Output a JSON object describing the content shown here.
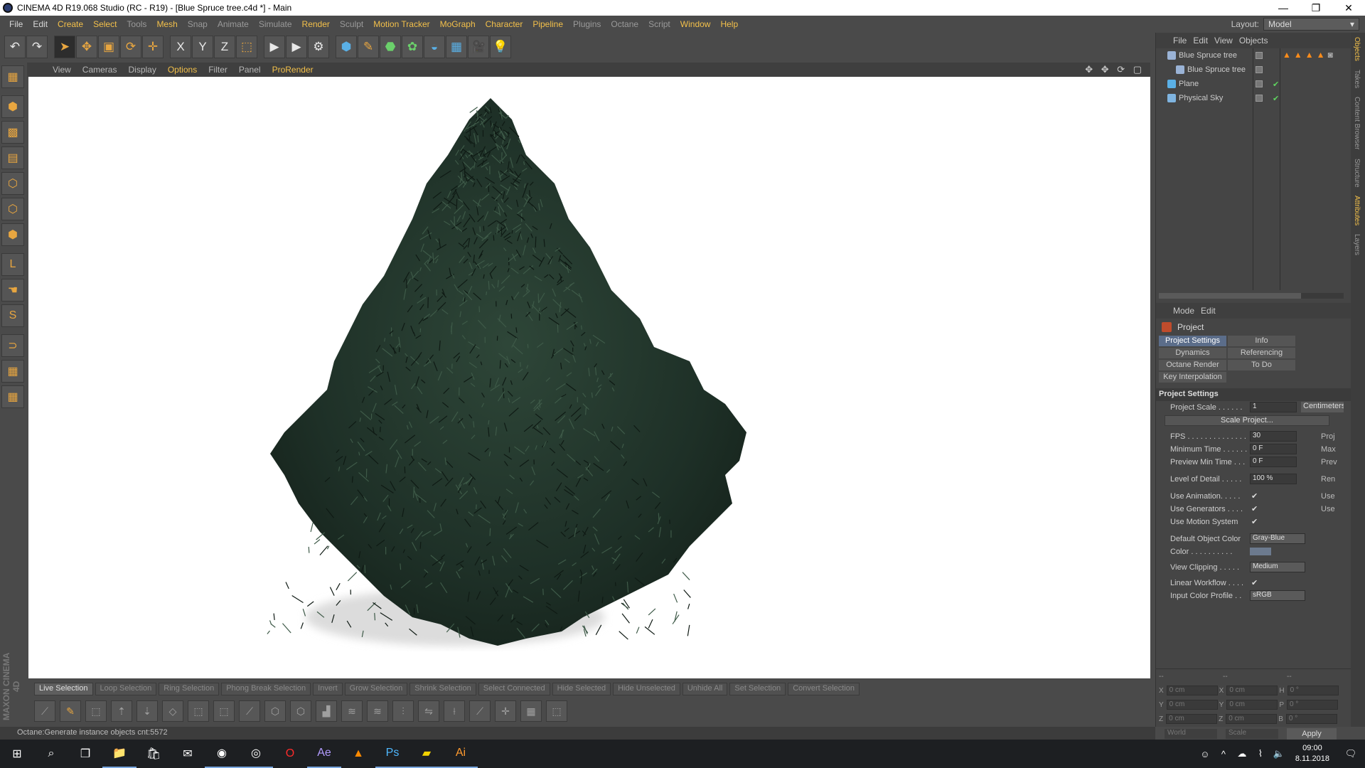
{
  "window": {
    "title": "CINEMA 4D R19.068 Studio (RC - R19) - [Blue Spruce tree.c4d *] - Main",
    "minimize": "—",
    "maximize": "❐",
    "close": "✕"
  },
  "menubar": {
    "items": [
      "File",
      "Edit",
      "Create",
      "Select",
      "Tools",
      "Mesh",
      "Snap",
      "Animate",
      "Simulate",
      "Render",
      "Sculpt",
      "Motion Tracker",
      "MoGraph",
      "Character",
      "Pipeline",
      "Plugins",
      "Octane",
      "Script",
      "Window",
      "Help"
    ],
    "layout_label": "Layout:",
    "layout_value": "Model"
  },
  "viewport_menu": {
    "items": [
      "View",
      "Cameras",
      "Display",
      "Options",
      "Filter",
      "Panel",
      "ProRender"
    ],
    "nav_icons": "✥ ✥ ⟳ ▢"
  },
  "toolbar": {
    "buttons": [
      {
        "name": "undo-icon",
        "glyph": "↶"
      },
      {
        "name": "redo-icon",
        "glyph": "↷"
      },
      {
        "name": "live-selection-icon",
        "glyph": "➤"
      },
      {
        "name": "move-icon",
        "glyph": "✥"
      },
      {
        "name": "scale-icon",
        "glyph": "▣"
      },
      {
        "name": "rotate-icon",
        "glyph": "⟳"
      },
      {
        "name": "add-icon",
        "glyph": "✛"
      },
      {
        "name": "x-axis-icon",
        "glyph": "X"
      },
      {
        "name": "y-axis-icon",
        "glyph": "Y"
      },
      {
        "name": "z-axis-icon",
        "glyph": "Z"
      },
      {
        "name": "coordinate-system-icon",
        "glyph": "⬚"
      },
      {
        "name": "render-view-icon",
        "glyph": "▶"
      },
      {
        "name": "render-picture-viewer-icon",
        "glyph": "▶"
      },
      {
        "name": "render-settings-icon",
        "glyph": "⚙"
      },
      {
        "name": "cube-icon",
        "glyph": "⬢"
      },
      {
        "name": "pen-icon",
        "glyph": "✎"
      },
      {
        "name": "subdivision-icon",
        "glyph": "⬣"
      },
      {
        "name": "cloner-icon",
        "glyph": "✿"
      },
      {
        "name": "deformer-icon",
        "glyph": "◒"
      },
      {
        "name": "floor-icon",
        "glyph": "▦"
      },
      {
        "name": "camera-icon",
        "glyph": "🎥"
      },
      {
        "name": "light-icon",
        "glyph": "💡"
      }
    ]
  },
  "left_tools": [
    {
      "name": "make-editable-icon",
      "glyph": "▦"
    },
    {
      "name": "model-mode-icon",
      "glyph": "⬢"
    },
    {
      "name": "texture-mode-icon",
      "glyph": "▩"
    },
    {
      "name": "workplane-icon",
      "glyph": "▤"
    },
    {
      "name": "points-mode-icon",
      "glyph": "⬡"
    },
    {
      "name": "edges-mode-icon",
      "glyph": "⬡"
    },
    {
      "name": "polygons-mode-icon",
      "glyph": "⬢"
    },
    {
      "name": "axis-mode-icon",
      "glyph": "L"
    },
    {
      "name": "tweak-mode-icon",
      "glyph": "☚"
    },
    {
      "name": "snap-icon",
      "glyph": "S"
    },
    {
      "name": "magnet-icon",
      "glyph": "⊃"
    },
    {
      "name": "workplane-lock-icon",
      "glyph": "▦"
    },
    {
      "name": "viewport-solo-icon",
      "glyph": "▦"
    }
  ],
  "brand": {
    "logo_text": "MAXON CINEMA 4D"
  },
  "selection_bar": {
    "buttons": [
      "Live Selection",
      "Loop Selection",
      "Ring Selection",
      "Phong Break Selection",
      "Invert",
      "Grow Selection",
      "Shrink Selection",
      "Select Connected",
      "Hide Selected",
      "Hide Unselected",
      "Unhide All",
      "Set Selection",
      "Convert Selection"
    ]
  },
  "bottom_tools": [
    {
      "name": "knife-icon",
      "glyph": "⟋"
    },
    {
      "name": "brush-icon",
      "glyph": "✎"
    },
    {
      "name": "iron-icon",
      "glyph": "⬚"
    },
    {
      "name": "extrude-icon",
      "glyph": "⇡"
    },
    {
      "name": "extrude-inner-icon",
      "glyph": "⇣"
    },
    {
      "name": "bevel-icon",
      "glyph": "◇"
    },
    {
      "name": "bridge-icon",
      "glyph": "⬚"
    },
    {
      "name": "weld-icon",
      "glyph": "⬚"
    },
    {
      "name": "slide-icon",
      "glyph": "⟋"
    },
    {
      "name": "stitch-icon",
      "glyph": "⬡"
    },
    {
      "name": "close-hole-icon",
      "glyph": "⬡"
    },
    {
      "name": "mirror-icon",
      "glyph": "▟"
    },
    {
      "name": "melt-icon",
      "glyph": "≋"
    },
    {
      "name": "dissolve-icon",
      "glyph": "≋"
    },
    {
      "name": "align-normals-icon",
      "glyph": "⫶"
    },
    {
      "name": "reverse-normals-icon",
      "glyph": "⇋"
    },
    {
      "name": "line-cut-icon",
      "glyph": "⟊"
    },
    {
      "name": "plane-cut-icon",
      "glyph": "⟋"
    },
    {
      "name": "add-point-icon",
      "glyph": "✛"
    },
    {
      "name": "array-icon",
      "glyph": "▦"
    },
    {
      "name": "optimize-icon",
      "glyph": "⬚"
    }
  ],
  "status": {
    "text": "Octane:Generate instance objects cnt:5572"
  },
  "object_manager": {
    "menu": [
      "File",
      "Edit",
      "View",
      "Objects"
    ],
    "objects": [
      {
        "name": "Blue Spruce tree",
        "indent": 0,
        "icon_color": "#9ab3d6",
        "checked": false
      },
      {
        "name": "Blue Spruce tree",
        "indent": 1,
        "icon_color": "#9ab3d6",
        "checked": false
      },
      {
        "name": "Plane",
        "indent": 0,
        "icon_color": "#5ab0e6",
        "checked": true
      },
      {
        "name": "Physical Sky",
        "indent": 0,
        "icon_color": "#7fb4e0",
        "checked": true
      }
    ]
  },
  "attribute_manager": {
    "menu": [
      "Mode",
      "Edit"
    ],
    "header": "Project",
    "tabs": [
      "Project Settings",
      "Info",
      "Dynamics",
      "Referencing",
      "Octane Render",
      "To Do",
      "Key Interpolation"
    ],
    "section_title": "Project Settings",
    "project_scale_label": "Project Scale . . . . . .",
    "project_scale_value": "1",
    "project_scale_unit": "Centimeters",
    "scale_project_button": "Scale Project...",
    "fps_label": "FPS . . . . . . . . . . . . . .",
    "fps_value": "30",
    "fps_side": "Proj",
    "min_time_label": "Minimum Time . . . . . .",
    "min_time_value": "0 F",
    "min_time_side": "Max",
    "prev_min_label": "Preview Min Time . . .",
    "prev_min_value": "0 F",
    "prev_min_side": "Prev",
    "lod_label": "Level of Detail . . . . .",
    "lod_value": "100 %",
    "lod_side": "Ren",
    "use_anim_label": "Use Animation. . . . .",
    "use_anim_side": "Use",
    "use_gen_label": "Use Generators . . . .",
    "use_gen_side": "Use",
    "use_motion_label": "Use Motion System",
    "default_color_label": "Default Object Color",
    "default_color_value": "Gray-Blue",
    "color_label": "Color . . . . . . . . . .",
    "view_clip_label": "View Clipping . . . . .",
    "view_clip_value": "Medium",
    "linear_label": "Linear Workflow . . . .",
    "input_profile_label": "Input Color Profile . .",
    "input_profile_value": "sRGB",
    "check_mark": "✔"
  },
  "coordinates": {
    "header": "--",
    "header2": "--",
    "header3": "--",
    "rows": [
      {
        "a": "X",
        "av": "0 cm",
        "b": "X",
        "bv": "0 cm",
        "c": "H",
        "cv": "0 °"
      },
      {
        "a": "Y",
        "av": "0 cm",
        "b": "Y",
        "bv": "0 cm",
        "c": "P",
        "cv": "0 °"
      },
      {
        "a": "Z",
        "av": "0 cm",
        "b": "Z",
        "bv": "0 cm",
        "c": "B",
        "cv": "0 °"
      }
    ],
    "space": "World",
    "mode": "Scale",
    "apply": "Apply"
  },
  "side_tabs": [
    "Objects",
    "Takes",
    "Content Browser",
    "Structure",
    "Attributes",
    "Layers"
  ],
  "taskbar": {
    "apps": [
      {
        "name": "windows-start-icon",
        "glyph": "⊞"
      },
      {
        "name": "search-icon",
        "glyph": "⌕"
      },
      {
        "name": "task-view-icon",
        "glyph": "❐"
      },
      {
        "name": "file-explorer-icon",
        "glyph": "📁"
      },
      {
        "name": "store-icon",
        "glyph": "🛍"
      },
      {
        "name": "mail-icon",
        "glyph": "✉"
      },
      {
        "name": "chrome-icon",
        "glyph": "◉"
      },
      {
        "name": "cinema4d-icon",
        "glyph": "◎"
      },
      {
        "name": "opera-icon",
        "glyph": "O"
      },
      {
        "name": "after-effects-icon",
        "glyph": "Ae"
      },
      {
        "name": "vlc-icon",
        "glyph": "▲"
      },
      {
        "name": "photoshop-icon",
        "glyph": "Ps"
      },
      {
        "name": "sticky-notes-icon",
        "glyph": "▰"
      },
      {
        "name": "illustrator-icon",
        "glyph": "Ai"
      }
    ],
    "time": "09:00",
    "date": "8.11.2018"
  },
  "colors": {
    "accent": "#f3c04a",
    "ui_bg": "#4a4a4a",
    "tree_dark": "#1b2a22",
    "tree_mid": "#2c4234"
  }
}
